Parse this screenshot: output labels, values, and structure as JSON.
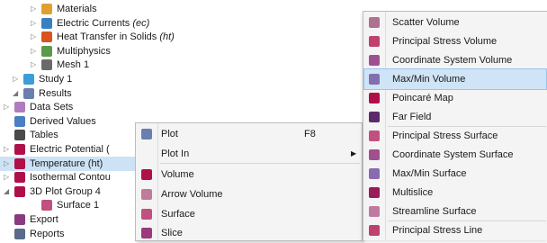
{
  "tree": [
    {
      "label": "Materials",
      "suffix": "",
      "indent": 2,
      "expander": "▷",
      "color": "#e0a030",
      "selected": false
    },
    {
      "label": "Electric Currents",
      "suffix": "(ec)",
      "indent": 2,
      "expander": "▷",
      "color": "#3a7fc1",
      "selected": false
    },
    {
      "label": "Heat Transfer in Solids",
      "suffix": "(ht)",
      "indent": 2,
      "expander": "▷",
      "color": "#d9541e",
      "selected": false
    },
    {
      "label": "Multiphysics",
      "suffix": "",
      "indent": 2,
      "expander": "▷",
      "color": "#5a9a4a",
      "selected": false
    },
    {
      "label": "Mesh 1",
      "suffix": "",
      "indent": 2,
      "expander": "▷",
      "color": "#6a6a6a",
      "selected": false
    },
    {
      "label": "Study 1",
      "suffix": "",
      "indent": 0,
      "expander": "▷",
      "color": "#3a9fd8",
      "selected": false
    },
    {
      "label": "Results",
      "suffix": "",
      "indent": 0,
      "expander": "◢",
      "color": "#6a7fb0",
      "selected": false
    },
    {
      "label": "Data Sets",
      "suffix": "",
      "indent": 1,
      "expander": "▷",
      "color": "#b07cc0",
      "selected": false
    },
    {
      "label": "Derived Values",
      "suffix": "",
      "indent": 1,
      "expander": "",
      "color": "#4a7fc0",
      "selected": false
    },
    {
      "label": "Tables",
      "suffix": "",
      "indent": 1,
      "expander": "",
      "color": "#4a4a4a",
      "selected": false
    },
    {
      "label": "Electric Potential (",
      "suffix": "",
      "indent": 1,
      "expander": "▷",
      "color": "#b0104a",
      "selected": false
    },
    {
      "label": "Temperature (ht)",
      "suffix": "",
      "indent": 1,
      "expander": "▷",
      "color": "#b0104a",
      "selected": true
    },
    {
      "label": "Isothermal Contou",
      "suffix": "",
      "indent": 1,
      "expander": "▷",
      "color": "#b0104a",
      "selected": false
    },
    {
      "label": "3D Plot Group 4",
      "suffix": "",
      "indent": 1,
      "expander": "◢",
      "color": "#b0104a",
      "selected": false
    },
    {
      "label": "Surface 1",
      "suffix": "",
      "indent": 2,
      "expander": "",
      "color": "#c05080",
      "selected": false
    },
    {
      "label": "Export",
      "suffix": "",
      "indent": 1,
      "expander": "",
      "color": "#8a3a80",
      "selected": false
    },
    {
      "label": "Reports",
      "suffix": "",
      "indent": 1,
      "expander": "",
      "color": "#5a6a8a",
      "selected": false
    }
  ],
  "context_menu": [
    {
      "label": "Plot",
      "shortcut": "F8",
      "submenu": false,
      "icon": "plot-icon",
      "color": "#6a7fb0"
    },
    {
      "label": "Plot In",
      "shortcut": "",
      "submenu": true,
      "icon": "",
      "color": ""
    },
    {
      "label": "Volume",
      "shortcut": "",
      "submenu": false,
      "icon": "volume-icon",
      "color": "#b0104a"
    },
    {
      "label": "Arrow Volume",
      "shortcut": "",
      "submenu": false,
      "icon": "arrow-volume-icon",
      "color": "#c07a9a"
    },
    {
      "label": "Surface",
      "shortcut": "",
      "submenu": false,
      "icon": "surface-icon",
      "color": "#c05080"
    },
    {
      "label": "Slice",
      "shortcut": "",
      "submenu": false,
      "icon": "slice-icon",
      "color": "#9a3a7a"
    }
  ],
  "submenu": [
    {
      "label": "Scatter Volume",
      "icon": "scatter-volume-icon",
      "color": "#b07090",
      "highlight": false
    },
    {
      "label": "Principal Stress Volume",
      "icon": "principal-stress-volume-icon",
      "color": "#c04070",
      "highlight": false
    },
    {
      "label": "Coordinate System Volume",
      "icon": "coordinate-system-volume-icon",
      "color": "#a05090",
      "highlight": false
    },
    {
      "label": "Max/Min Volume",
      "icon": "max-min-volume-icon",
      "color": "#8070b0",
      "highlight": true
    },
    {
      "label": "Poincaré Map",
      "icon": "poincare-map-icon",
      "color": "#b0104a",
      "highlight": false
    },
    {
      "label": "Far Field",
      "icon": "far-field-icon",
      "color": "#5a2a6a",
      "highlight": false
    },
    {
      "label": "Principal Stress Surface",
      "icon": "principal-stress-surface-icon",
      "color": "#c05080",
      "highlight": false
    },
    {
      "label": "Coordinate System Surface",
      "icon": "coordinate-system-surface-icon",
      "color": "#a05090",
      "highlight": false
    },
    {
      "label": "Max/Min Surface",
      "icon": "max-min-surface-icon",
      "color": "#8a6ab0",
      "highlight": false
    },
    {
      "label": "Multislice",
      "icon": "multislice-icon",
      "color": "#9a1a5a",
      "highlight": false
    },
    {
      "label": "Streamline Surface",
      "icon": "streamline-surface-icon",
      "color": "#c07aa0",
      "highlight": false
    },
    {
      "label": "Principal Stress Line",
      "icon": "principal-stress-line-icon",
      "color": "#c04070",
      "highlight": false
    }
  ]
}
